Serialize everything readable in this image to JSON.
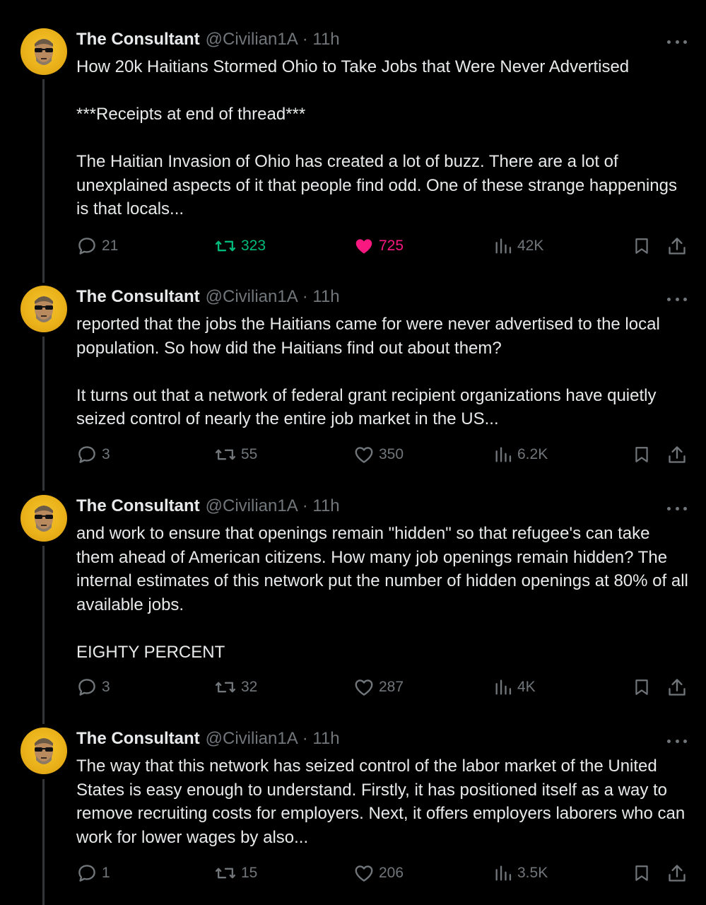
{
  "colors": {
    "background": "#000000",
    "text": "#e7e9ea",
    "muted": "#71767b",
    "retweet_active": "#00ba7c",
    "like_active": "#f91880",
    "avatar": "#f0b821"
  },
  "tweets": [
    {
      "name": "The Consultant",
      "handle": "@Civilian1A",
      "time": "· 11h",
      "text": "How 20k Haitians Stormed Ohio to Take Jobs that Were Never Advertised\n\n***Receipts at end of thread***\n\nThe Haitian Invasion of Ohio has created a lot of buzz. There are a lot of unexplained aspects of it that people find odd. One of these strange happenings is that locals...",
      "replies": "21",
      "reposts": "323",
      "likes": "725",
      "views": "42K",
      "reposted": true,
      "liked": true
    },
    {
      "name": "The Consultant",
      "handle": "@Civilian1A",
      "time": "· 11h",
      "text": "reported that the jobs the Haitians came for were never advertised to the local population. So how did the Haitians find out about them?\n\nIt turns out that a network of federal grant recipient organizations have quietly seized control of nearly the entire job market in the US...",
      "replies": "3",
      "reposts": "55",
      "likes": "350",
      "views": "6.2K",
      "reposted": false,
      "liked": false
    },
    {
      "name": "The Consultant",
      "handle": "@Civilian1A",
      "time": "· 11h",
      "text": "and work to ensure that openings remain \"hidden\" so that refugee's can take them ahead of American citizens. How many job openings remain hidden? The internal estimates of this network put the number of hidden openings at 80% of all available jobs.\n\nEIGHTY PERCENT",
      "replies": "3",
      "reposts": "32",
      "likes": "287",
      "views": "4K",
      "reposted": false,
      "liked": false
    },
    {
      "name": "The Consultant",
      "handle": "@Civilian1A",
      "time": "· 11h",
      "text": "The way that this network has seized control of the labor market of the United States is easy enough to understand. Firstly, it has positioned itself as a way to remove recruiting costs for employers. Next, it offers employers laborers who can work for lower wages by also...",
      "replies": "1",
      "reposts": "15",
      "likes": "206",
      "views": "3.5K",
      "reposted": false,
      "liked": false
    }
  ],
  "icons": {
    "avatar": "avatar-sunglasses-icon",
    "more": "more-dots-icon",
    "reply": "reply-icon",
    "repost": "repost-icon",
    "like": "heart-icon",
    "views": "views-chart-icon",
    "bookmark": "bookmark-icon",
    "share": "share-icon"
  }
}
